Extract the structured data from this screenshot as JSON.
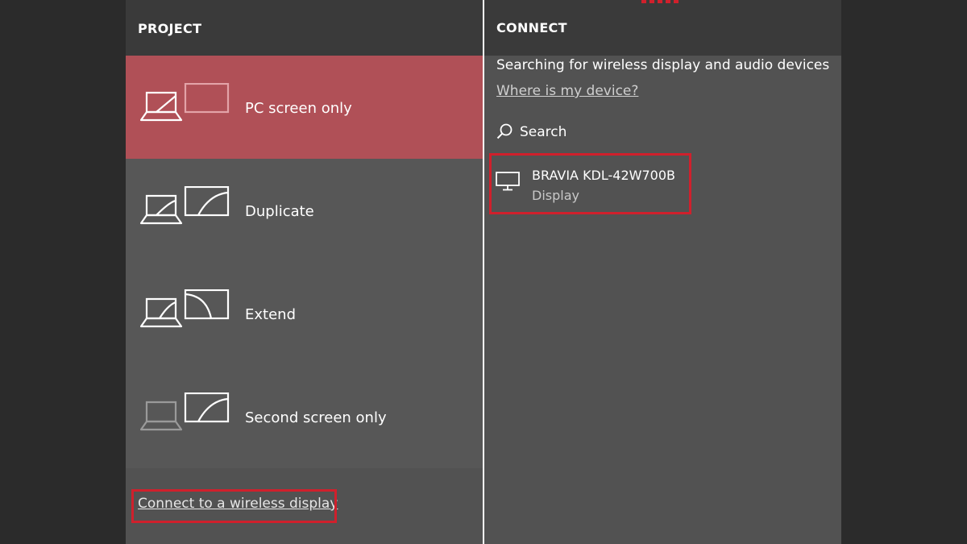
{
  "project": {
    "title": "PROJECT",
    "options": [
      {
        "label": "PC screen only",
        "selected": true,
        "icon": "pc-screen-only-icon"
      },
      {
        "label": "Duplicate",
        "selected": false,
        "icon": "duplicate-icon"
      },
      {
        "label": "Extend",
        "selected": false,
        "icon": "extend-icon"
      },
      {
        "label": "Second screen only",
        "selected": false,
        "icon": "second-screen-only-icon"
      }
    ],
    "connect_link": "Connect to a wireless display"
  },
  "connect": {
    "title": "CONNECT",
    "status": "Searching for wireless display and audio devices",
    "help_link": "Where is my device?",
    "search_label": "Search",
    "devices": [
      {
        "name": "BRAVIA KDL-42W700B",
        "type": "Display",
        "icon": "monitor-icon"
      }
    ]
  },
  "colors": {
    "selected_option": "#b05057",
    "panel_bg": "#525252",
    "highlight_box": "#d0202c"
  }
}
